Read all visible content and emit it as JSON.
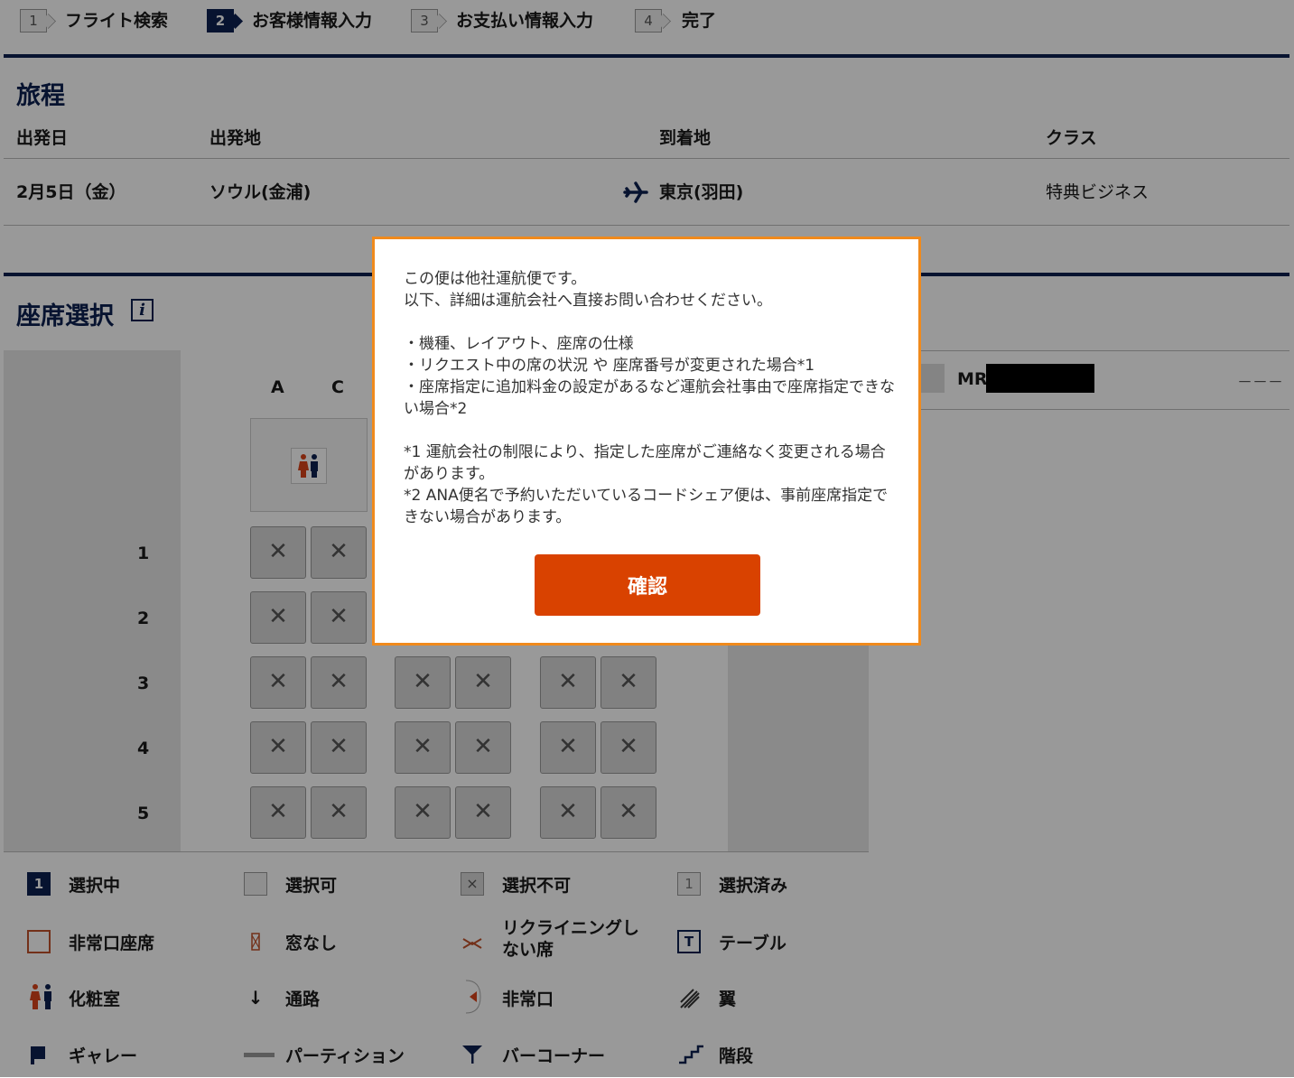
{
  "steps": [
    {
      "num": "1",
      "label": "フライト検索"
    },
    {
      "num": "2",
      "label": "お客様情報入力"
    },
    {
      "num": "3",
      "label": "お支払い情報入力"
    },
    {
      "num": "4",
      "label": "完了"
    }
  ],
  "itinerary": {
    "title": "旅程",
    "headers": {
      "date": "出発日",
      "origin": "出発地",
      "destination": "到着地",
      "class": "クラス"
    },
    "row": {
      "date": "2月5日（金）",
      "origin": "ソウル(金浦)",
      "destination": "東京(羽田)",
      "class": "特典ビジネス"
    }
  },
  "seat_selection": {
    "title": "座席選択",
    "info_icon": "i",
    "columns": [
      "A",
      "C"
    ],
    "rows": [
      "1",
      "2",
      "3",
      "4",
      "5"
    ],
    "unavailable_mark": "✕"
  },
  "passenger": {
    "name": "MR",
    "seat": "－－－"
  },
  "legend": [
    {
      "label": "選択中",
      "icon": "selected-icon",
      "icon_text": "1"
    },
    {
      "label": "選択可",
      "icon": "available-icon"
    },
    {
      "label": "選択不可",
      "icon": "unavailable-icon",
      "icon_text": "×"
    },
    {
      "label": "選択済み",
      "icon": "selected-done-icon",
      "icon_text": "1"
    },
    {
      "label": "非常口座席",
      "icon": "exit-seat-icon"
    },
    {
      "label": "窓なし",
      "icon": "no-window-icon"
    },
    {
      "label": "リクライニングしない席",
      "icon": "no-recline-icon"
    },
    {
      "label": "テーブル",
      "icon": "table-icon",
      "icon_text": "T"
    },
    {
      "label": "化粧室",
      "icon": "lavatory-icon"
    },
    {
      "label": "通路",
      "icon": "aisle-icon",
      "icon_text": "↓"
    },
    {
      "label": "非常口",
      "icon": "emergency-exit-icon"
    },
    {
      "label": "翼",
      "icon": "wing-icon"
    },
    {
      "label": "ギャレー",
      "icon": "galley-icon"
    },
    {
      "label": "パーティション",
      "icon": "partition-icon"
    },
    {
      "label": "バーコーナー",
      "icon": "bar-corner-icon"
    },
    {
      "label": "階段",
      "icon": "stairs-icon"
    }
  ],
  "modal": {
    "line1": "この便は他社運航便です。",
    "line2": "以下、詳細は運航会社へ直接お問い合わせください。",
    "bullet1": "・機種、レイアウト、座席の仕様",
    "bullet2": "・リクエスト中の席の状況 や 座席番号が変更された場合*1",
    "bullet3": "・座席指定に追加料金の設定があるなど運航会社事由で座席指定できない場合*2",
    "note1": "*1 運航会社の制限により、指定した座席がご連絡なく変更される場合があります。",
    "note2": "*2 ANA便名で予約いただいているコードシェア便は、事前座席指定できない場合があります。",
    "confirm_label": "確認"
  },
  "colors": {
    "navy": "#0d2151",
    "confirm": "#d94200",
    "modal_border": "#f08a1c"
  }
}
